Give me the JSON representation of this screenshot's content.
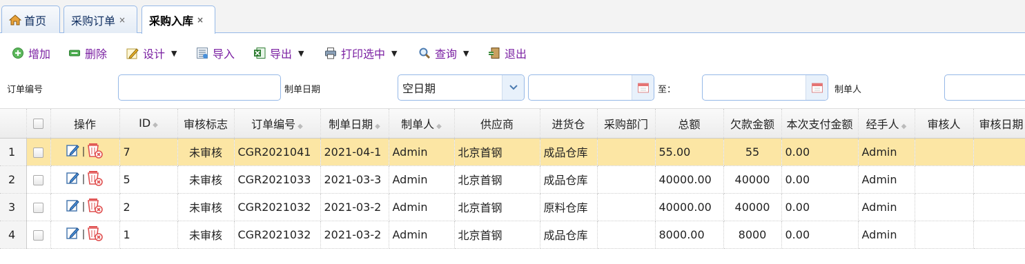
{
  "tabs": [
    {
      "label": "首页",
      "closable": false,
      "active": false
    },
    {
      "label": "采购订单",
      "closable": true,
      "active": false
    },
    {
      "label": "采购入库",
      "closable": true,
      "active": true
    }
  ],
  "tab_close_glyph": "×",
  "toolbar": {
    "add": "增加",
    "delete": "删除",
    "design": "设计",
    "import": "导入",
    "export": "导出",
    "print": "打印选中",
    "query": "查询",
    "exit": "退出",
    "label_color": "#7a1fa2"
  },
  "search": {
    "order_no_label": "订单编号",
    "order_no_value": "",
    "date_label": "制单日期",
    "date_select_value": "空日期",
    "to_label": "至：",
    "creator_label": "制单人"
  },
  "grid": {
    "columns": [
      "操作",
      "ID",
      "审核标志",
      "订单编号",
      "制单日期",
      "制单人",
      "供应商",
      "进货仓",
      "采购部门",
      "总额",
      "欠款金额",
      "本次支付金额",
      "经手人",
      "审核人",
      "审核日期"
    ],
    "rows": [
      {
        "rn": "1",
        "id": "7",
        "status": "未审核",
        "order_no": "CGR2021041",
        "date": "2021-04-1",
        "creator": "Admin",
        "supplier": "北京首钢",
        "warehouse": "成品仓库",
        "dept": "",
        "total": "55.00",
        "debt": "55",
        "paid": "0.00",
        "handler": "Admin",
        "auditor": "",
        "audit_date": ""
      },
      {
        "rn": "2",
        "id": "5",
        "status": "未审核",
        "order_no": "CGR2021033",
        "date": "2021-03-3",
        "creator": "Admin",
        "supplier": "北京首钢",
        "warehouse": "成品仓库",
        "dept": "",
        "total": "40000.00",
        "debt": "40000",
        "paid": "0.00",
        "handler": "Admin",
        "auditor": "",
        "audit_date": ""
      },
      {
        "rn": "3",
        "id": "2",
        "status": "未审核",
        "order_no": "CGR2021032",
        "date": "2021-03-2",
        "creator": "Admin",
        "supplier": "北京首钢",
        "warehouse": "原料仓库",
        "dept": "",
        "total": "40000.00",
        "debt": "40000",
        "paid": "0.00",
        "handler": "Admin",
        "auditor": "",
        "audit_date": ""
      },
      {
        "rn": "4",
        "id": "1",
        "status": "未审核",
        "order_no": "CGR2021032",
        "date": "2021-03-2",
        "creator": "Admin",
        "supplier": "北京首钢",
        "warehouse": "成品仓库",
        "dept": "",
        "total": "8000.00",
        "debt": "8000",
        "paid": "0.00",
        "handler": "Admin",
        "auditor": "",
        "audit_date": ""
      }
    ],
    "selected_row": 0,
    "selected_color": "#fce6a4"
  }
}
